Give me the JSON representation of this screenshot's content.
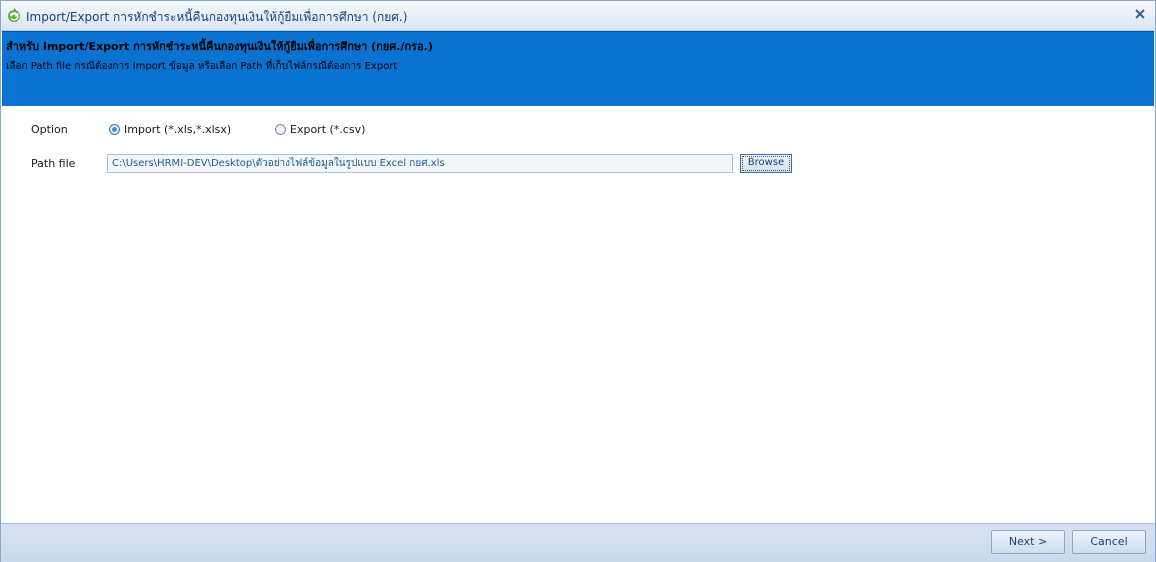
{
  "window": {
    "title": "Import/Export การหักชำระหนี้คืนกองทุนเงินให้กู้ยืมเพื่อการศึกษา (กยศ.)",
    "app_icon": "green-recycle-icon",
    "close_icon": "close-icon"
  },
  "banner": {
    "title": "สำหรับ Import/Export การหักชำระหนี้คืนกองทุนเงินให้กู้ยืมเพื่อการศึกษา (กยศ./กรอ.)",
    "description": "เลือก Path file กรณีต้องการ Import ข้อมูล หรือเลือก Path ที่เก็บไฟล์กรณีต้องการ Export",
    "color": "#0a73d2"
  },
  "form": {
    "option_label": "Option",
    "options": [
      {
        "label": "Import (*.xls,*.xlsx)",
        "checked": true
      },
      {
        "label": "Export (*.csv)",
        "checked": false
      }
    ],
    "path_label": "Path file",
    "path_value": "C:\\Users\\HRMI-DEV\\Desktop\\ตัวอย่างไฟล์ข้อมูลในรูปแบบ Excel กยศ.xls",
    "browse_label": "Browse"
  },
  "footer": {
    "next_label": "Next >",
    "cancel_label": "Cancel"
  }
}
